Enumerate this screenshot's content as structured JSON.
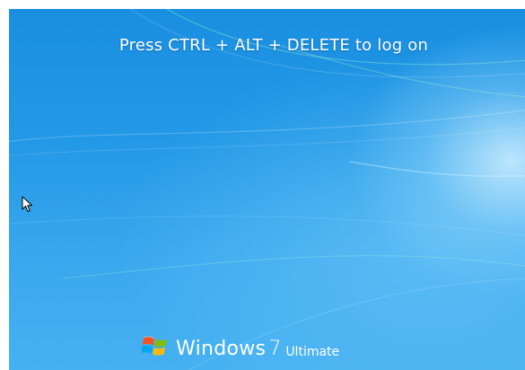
{
  "logon_screen": {
    "message": "Press CTRL + ALT + DELETE to log on"
  },
  "branding": {
    "product_name": "Windows",
    "version": "7",
    "edition": "Ultimate",
    "logo_icon": "windows-flag-icon"
  },
  "pointer": {
    "icon": "arrow-cursor-icon"
  },
  "colors": {
    "background_top": "#1a8fe0",
    "background_bottom": "#46b1f1",
    "text": "#ffffff",
    "flag_red": "#f35325",
    "flag_green": "#81bc06",
    "flag_blue": "#05a6f0",
    "flag_yellow": "#ffba08"
  }
}
